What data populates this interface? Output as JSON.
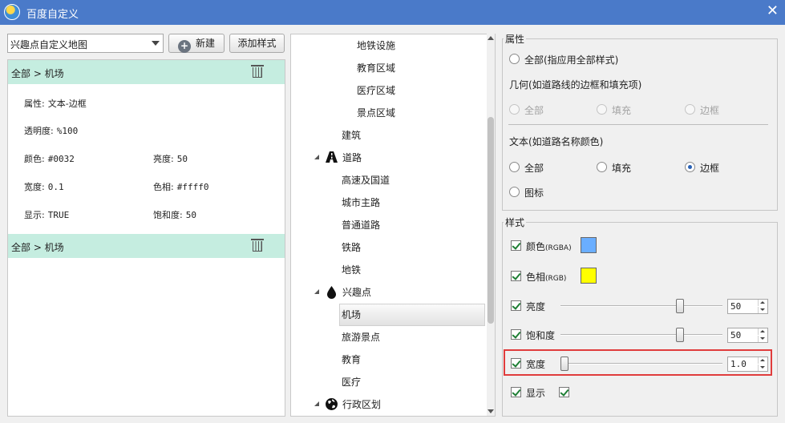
{
  "window": {
    "title": "百度自定义",
    "close_glyph": "✕"
  },
  "left": {
    "combo_value": "兴趣点自定义地图",
    "new_button": "新建",
    "add_style_button": "添加样式",
    "groups": [
      {
        "header": "全部 > 机场",
        "props": {
          "attr_label": "属性:",
          "attr_value": "文本-边框",
          "opacity_label": "透明度:",
          "opacity_value": "%100",
          "color_label": "颜色:",
          "color_value": "#0032",
          "brightness_label": "亮度:",
          "brightness_value": "50",
          "width_label": "宽度:",
          "width_value": "0.1",
          "hue_label": "色相:",
          "hue_value": "#ffff0",
          "visible_label": "显示:",
          "visible_value": "TRUE",
          "saturation_label": "饱和度:",
          "saturation_value": "50"
        }
      },
      {
        "header": "全部 > 机场"
      }
    ]
  },
  "tree": {
    "items": [
      {
        "label": "地铁设施"
      },
      {
        "label": "教育区域"
      },
      {
        "label": "医疗区域"
      },
      {
        "label": "景点区域"
      },
      {
        "label": "建筑"
      },
      {
        "label": "道路",
        "icon": "road-icon"
      },
      {
        "label": "高速及国道"
      },
      {
        "label": "城市主路"
      },
      {
        "label": "普通道路"
      },
      {
        "label": "铁路"
      },
      {
        "label": "地铁"
      },
      {
        "label": "兴趣点",
        "icon": "poi-drop-icon"
      },
      {
        "label": "机场",
        "selected": true
      },
      {
        "label": "旅游景点"
      },
      {
        "label": "教育"
      },
      {
        "label": "医疗"
      },
      {
        "label": "行政区划",
        "icon": "globe-icon"
      }
    ]
  },
  "right": {
    "attr_group_title": "属性",
    "all_apply": "全部(指应用全部样式)",
    "geometry_title": "几何(如道路线的边框和填充项)",
    "geometry_options": {
      "all": "全部",
      "fill": "填充",
      "border": "边框"
    },
    "text_title": "文本(如道路名称颜色)",
    "text_options": {
      "all": "全部",
      "fill": "填充",
      "border": "边框",
      "icon": "图标"
    },
    "text_selected": "边框",
    "style_group_title": "样式",
    "style": {
      "color_label": "颜色",
      "color_sub": "(RGBA)",
      "color_swatch": "#6aaeff",
      "hue_label": "色相",
      "hue_sub": "(RGB)",
      "hue_swatch": "#ffff00",
      "brightness_label": "亮度",
      "brightness_value": "50",
      "saturation_label": "饱和度",
      "saturation_value": "50",
      "width_label": "宽度",
      "width_value": "1.0",
      "visible_label": "显示"
    },
    "highlight_color": "#e03c3c"
  }
}
